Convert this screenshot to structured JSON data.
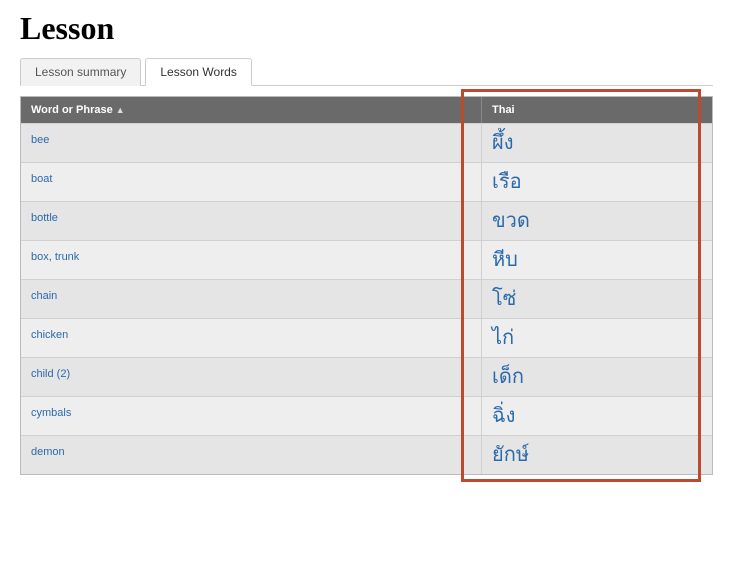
{
  "page_title": "Lesson",
  "tabs": [
    {
      "label": "Lesson summary",
      "active": false
    },
    {
      "label": "Lesson Words",
      "active": true
    }
  ],
  "table": {
    "headers": {
      "word": "Word or Phrase",
      "thai": "Thai"
    },
    "rows": [
      {
        "word": "bee",
        "thai": "ผึ้ง"
      },
      {
        "word": "boat",
        "thai": "เรือ"
      },
      {
        "word": "bottle",
        "thai": "ขวด"
      },
      {
        "word": "box, trunk",
        "thai": "หีบ"
      },
      {
        "word": "chain",
        "thai": "โซ่"
      },
      {
        "word": "chicken",
        "thai": "ไก่"
      },
      {
        "word": "child (2)",
        "thai": "เด็ก"
      },
      {
        "word": "cymbals",
        "thai": "ฉิ่ง"
      },
      {
        "word": "demon",
        "thai": "ยักษ์"
      }
    ]
  }
}
